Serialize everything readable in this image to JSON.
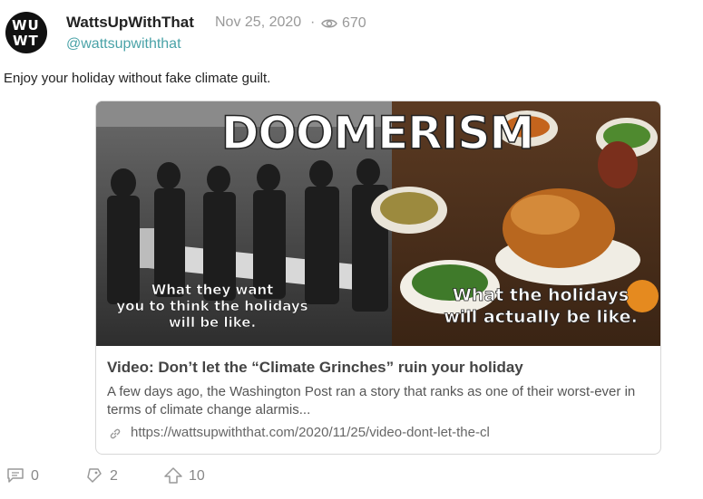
{
  "post": {
    "author_name": "WattsUpWithThat",
    "date": "Nov 25, 2020",
    "separator": "·",
    "views": "670",
    "handle": "@wattsupwiththat",
    "avatar_lines": [
      "WU",
      "WT"
    ],
    "body": "Enjoy your holiday without fake climate guilt."
  },
  "link_card": {
    "image": {
      "headline": "DOOMERISM",
      "left_caption": [
        "What they want",
        "you to think the holidays",
        "will be like."
      ],
      "right_caption": [
        "What the holidays",
        "will actually be like."
      ]
    },
    "title": "Video: Don’t let the “Climate Grinches” ruin your holiday",
    "description": "A few days ago, the Washington Post ran a story that ranks as one of their worst-ever in terms of climate change alarmis...",
    "url": "https://wattsupwiththat.com/2020/11/25/video-dont-let-the-cl"
  },
  "actions": {
    "comments": "0",
    "reposts": "2",
    "upvotes": "10"
  },
  "icons": [
    "eye-icon",
    "link-icon",
    "comment-icon",
    "repost-icon",
    "upvote-icon"
  ]
}
